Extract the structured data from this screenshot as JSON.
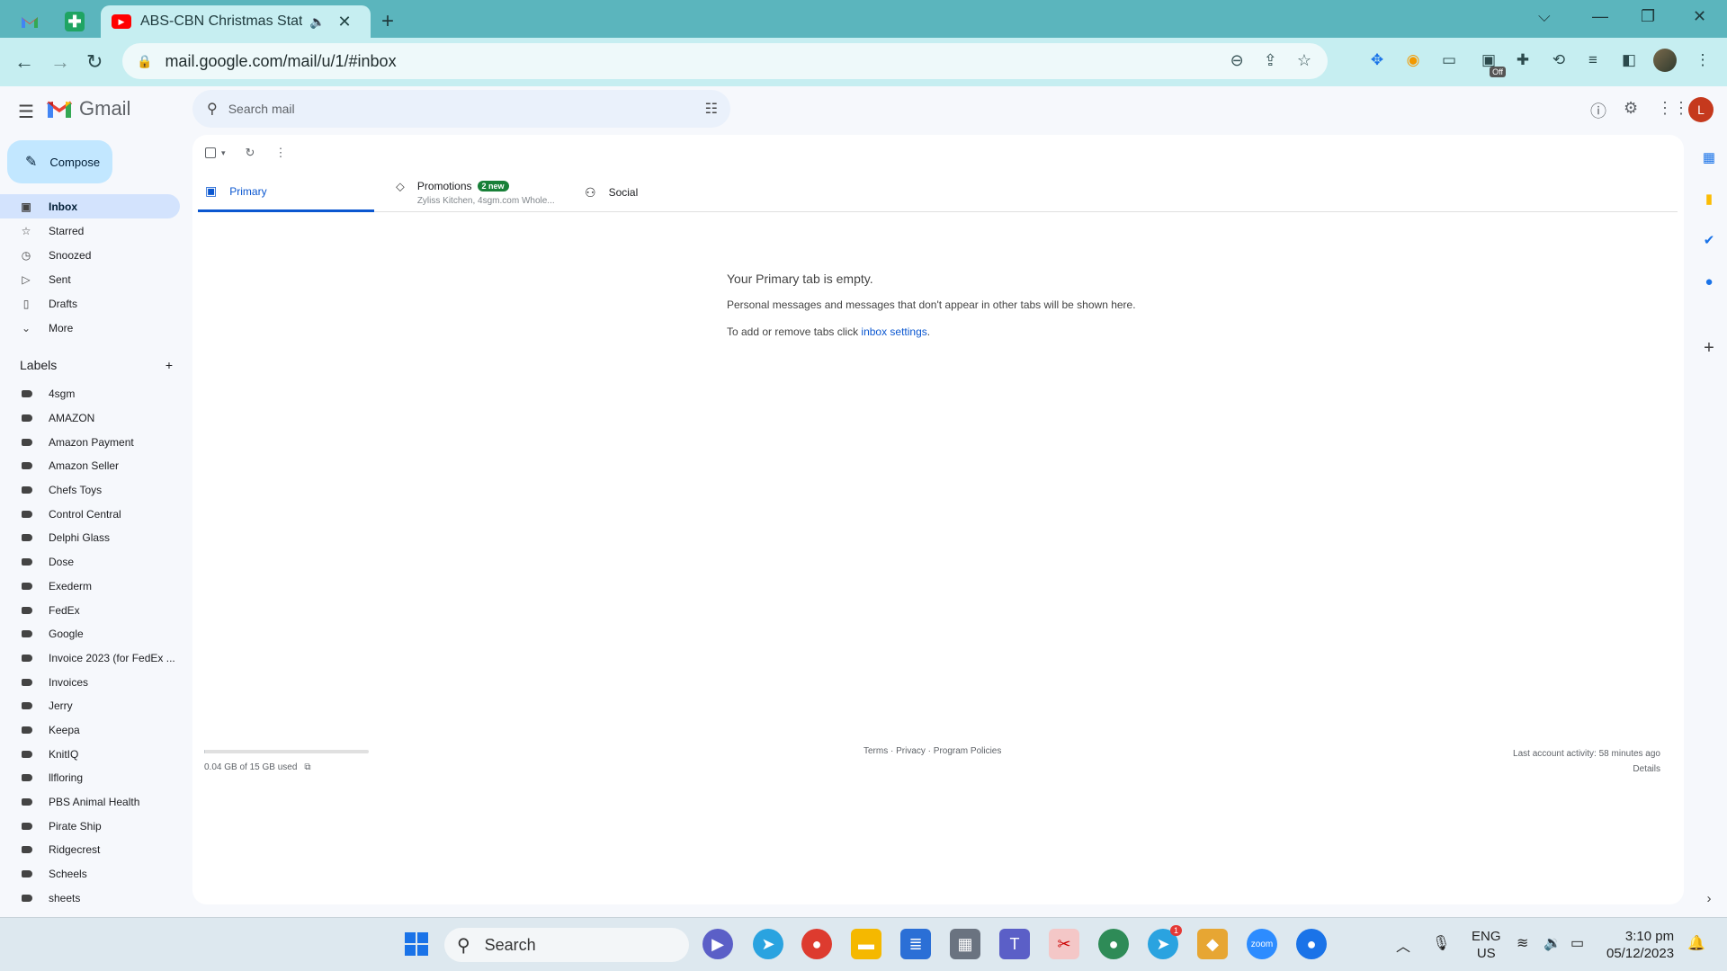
{
  "browser": {
    "tabs": [
      {
        "title": "ABS-CBN Christmas Station"
      }
    ],
    "url": "mail.google.com/mail/u/1/#inbox",
    "extension_off_badge": "Off"
  },
  "gmail": {
    "product_name": "Gmail",
    "search_placeholder": "Search mail",
    "avatar_letter": "L",
    "compose_label": "Compose",
    "nav": [
      {
        "label": "Inbox",
        "icon": "inbox-icon"
      },
      {
        "label": "Starred",
        "icon": "star-icon"
      },
      {
        "label": "Snoozed",
        "icon": "clock-icon"
      },
      {
        "label": "Sent",
        "icon": "send-icon"
      },
      {
        "label": "Drafts",
        "icon": "draft-icon"
      },
      {
        "label": "More",
        "icon": "chevron-down-icon"
      }
    ],
    "labels_heading": "Labels",
    "labels": [
      "4sgm",
      "AMAZON",
      "Amazon Payment",
      "Amazon Seller",
      "Chefs Toys",
      "Control Central",
      "Delphi Glass",
      "Dose",
      "Exederm",
      "FedEx",
      "Google",
      "Invoice 2023 (for FedEx ...",
      "Invoices",
      "Jerry",
      "Keepa",
      "KnitIQ",
      "llfloring",
      "PBS Animal Health",
      "Pirate Ship",
      "Ridgecrest",
      "Scheels",
      "sheets"
    ],
    "tabs": {
      "primary": "Primary",
      "promotions": "Promotions",
      "promotions_badge": "2 new",
      "promotions_preview": "Zyliss Kitchen, 4sgm.com Whole...",
      "social": "Social"
    },
    "empty_state": {
      "title": "Your Primary tab is empty.",
      "line1": "Personal messages and messages that don't appear in other tabs will be shown here.",
      "line2_prefix": "To add or remove tabs click ",
      "line2_link": "inbox settings",
      "line2_suffix": "."
    },
    "footer": {
      "storage_text": "0.04 GB of 15 GB used",
      "storage_fraction": 0.003,
      "links": "Terms · Privacy · Program Policies",
      "activity": "Last account activity: 58 minutes ago",
      "details": "Details"
    }
  },
  "taskbar": {
    "search_label": "Search",
    "telegram_badge": "1",
    "lang": "ENG",
    "region": "US",
    "time": "3:10 pm",
    "date": "05/12/2023"
  },
  "colors": {
    "accent": "#0b57d0",
    "compose_bg": "#c2e7ff",
    "chrome_frame": "#5bb5bd",
    "avatar": "#c5391d"
  }
}
